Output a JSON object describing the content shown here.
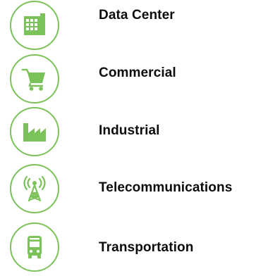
{
  "accent_color": "#7cc25a",
  "text_color": "#0b0b0b",
  "items": [
    {
      "label": "Data Center",
      "icon": "building-icon"
    },
    {
      "label": "Commercial",
      "icon": "shopping-cart-icon"
    },
    {
      "label": "Industrial",
      "icon": "factory-icon"
    },
    {
      "label": "Telecommunications",
      "icon": "cell-tower-icon"
    },
    {
      "label": "Transportation",
      "icon": "bus-icon"
    }
  ]
}
